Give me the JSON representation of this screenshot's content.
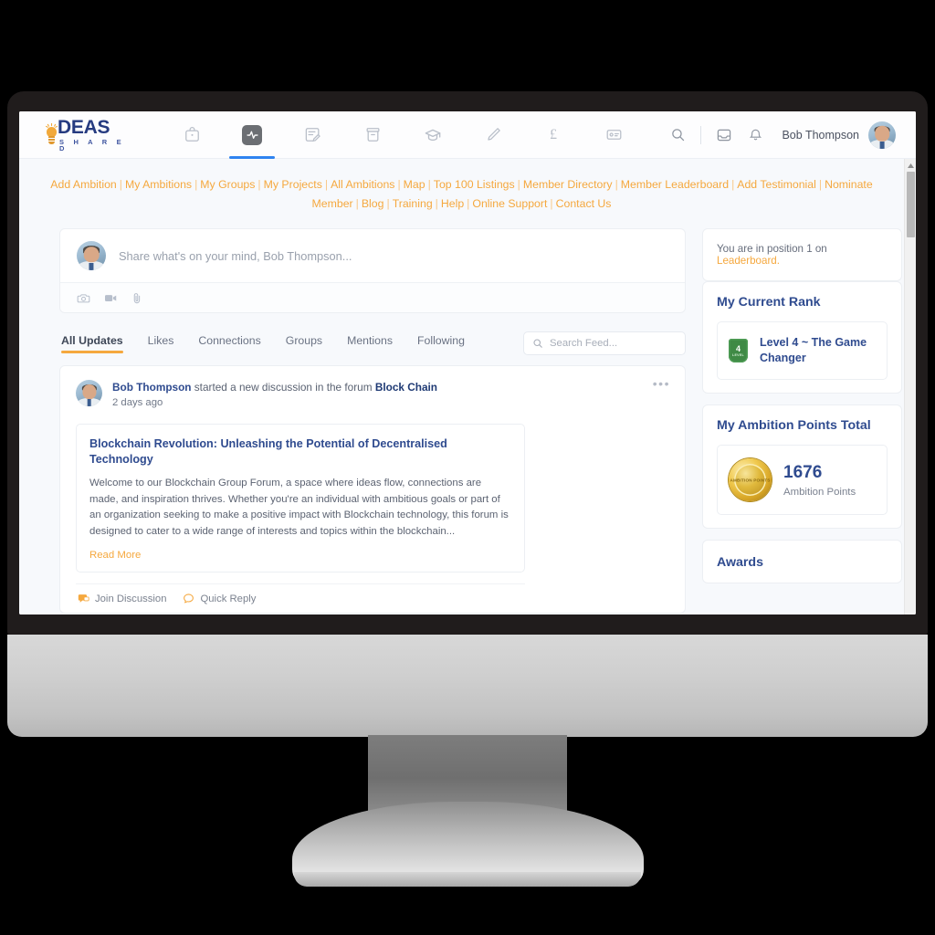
{
  "brand": {
    "logo_primary": "DEAS",
    "logo_secondary": "S H A R E D",
    "accent_orange": "#f5a83e",
    "accent_blue": "#2f4b8f",
    "nav_active_blue": "#2f83f0"
  },
  "topbar": {
    "nav_icons": [
      {
        "name": "briefcase-icon",
        "label": "Marketplace"
      },
      {
        "name": "activity-icon",
        "label": "Activity",
        "active": true
      },
      {
        "name": "note-edit-icon",
        "label": "Ambitions"
      },
      {
        "name": "archive-box-icon",
        "label": "Projects"
      },
      {
        "name": "graduation-cap-icon",
        "label": "Training"
      },
      {
        "name": "pencil-icon",
        "label": "Blog"
      },
      {
        "name": "pound-icon",
        "label": "£"
      },
      {
        "name": "id-card-icon",
        "label": "Directory"
      }
    ],
    "search_icon": "search-icon",
    "inbox_icon": "inbox-icon",
    "notifications_icon": "bell-icon",
    "user_name": "Bob Thompson",
    "avatar": "user-avatar"
  },
  "quicklinks": [
    "Add Ambition",
    "My Ambitions",
    "My Groups",
    "My Projects",
    "All Ambitions",
    "Map",
    "Top 100 Listings",
    "Member Directory",
    "Member Leaderboard",
    "Add Testimonial",
    "Nominate Member",
    "Blog",
    "Training",
    "Help",
    "Online Support",
    "Contact Us"
  ],
  "composer": {
    "placeholder": "Share what's on your mind, Bob Thompson...",
    "tools": [
      {
        "name": "camera-icon",
        "label": "Photo"
      },
      {
        "name": "video-icon",
        "label": "Video"
      },
      {
        "name": "attachment-icon",
        "label": "Attachment"
      }
    ]
  },
  "feed": {
    "tabs": [
      {
        "label": "All Updates",
        "active": true
      },
      {
        "label": "Likes",
        "active": false
      },
      {
        "label": "Connections",
        "active": false
      },
      {
        "label": "Groups",
        "active": false
      },
      {
        "label": "Mentions",
        "active": false
      },
      {
        "label": "Following",
        "active": false
      }
    ],
    "search_placeholder": "Search Feed...",
    "post": {
      "author": "Bob Thompson",
      "action": " started a new discussion in the forum ",
      "forum": "Block Chain",
      "time": "2 days ago",
      "menu": "•••",
      "title": "Blockchain Revolution: Unleashing the Potential of Decentralised Technology",
      "body": "Welcome to our Blockchain Group Forum, a space where ideas flow, connections are made, and inspiration thrives. Whether you're an individual with ambitious goals or part of an organization seeking to make a positive impact with Blockchain technology, this forum is designed to cater to a wide range of interests and topics within the blockchain...",
      "read_more": "Read More",
      "actions": [
        {
          "label": "Join Discussion",
          "icon": "discussion-icon"
        },
        {
          "label": "Quick Reply",
          "icon": "comment-icon"
        }
      ]
    }
  },
  "sidebar": {
    "leaderboard_note_prefix": "You are in position 1 on ",
    "leaderboard_note_link": "Leaderboard.",
    "rank": {
      "title": "My Current Rank",
      "badge_number": "4",
      "badge_label": "LEVEL",
      "text": "Level 4 ~ The Game Changer"
    },
    "points": {
      "title": "My Ambition Points Total",
      "medal_label": "AMBITION POINTS",
      "value": "1676",
      "caption": "Ambition Points"
    },
    "awards": {
      "title": "Awards"
    }
  }
}
